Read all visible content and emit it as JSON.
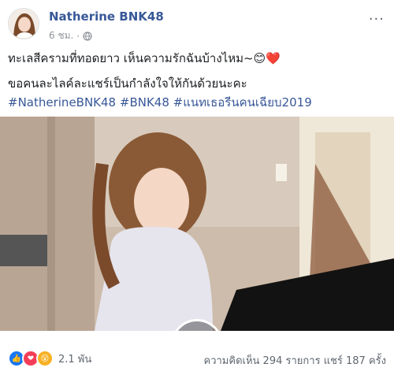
{
  "post": {
    "author": "Natherine BNK48",
    "timestamp": "6 ชม.",
    "privacy_icon": "globe-icon",
    "menu_icon": "more-options-icon",
    "line1": "ทะเลสีครามที่ทอดยาว เห็นความรักฉันบ้างไหม~😊❤️",
    "line2": "ขอคนละไลค์ละแชร์เป็นกำลังใจให้กันด้วยนะคะ",
    "hashtags": "#NatherineBNK48 #BNK48 #แนทเธอรีนคนเฉียบ2019"
  },
  "video": {
    "play_icon": "play-icon"
  },
  "footer": {
    "reaction_icons": [
      "like-icon",
      "love-icon",
      "wow-icon"
    ],
    "reaction_count": "2.1 พัน",
    "comments": "ความคิดเห็น 294 รายการ",
    "shares": "แชร์ 187 ครั้ง"
  },
  "colors": {
    "link": "#385898",
    "meta": "#90949c",
    "like": "#1877f2",
    "love": "#f33e58",
    "wow": "#f7b125"
  }
}
